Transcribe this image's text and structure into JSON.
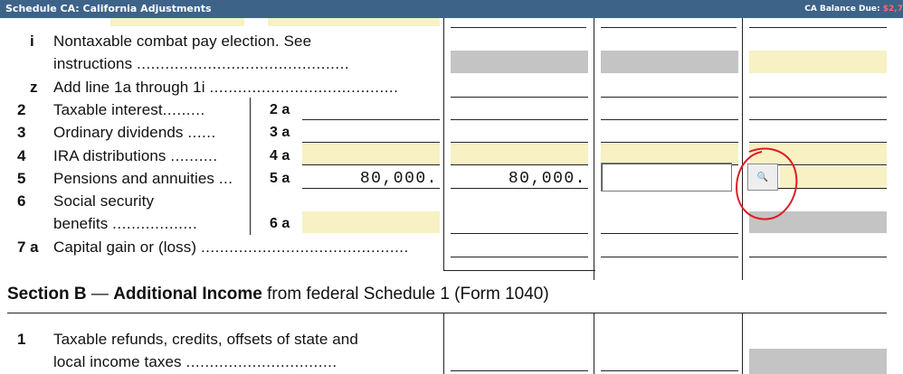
{
  "titlebar": {
    "title": "Schedule CA: California Adjustments",
    "balance_label": "CA Balance Due:",
    "balance_value": "$2,7"
  },
  "lines": {
    "i": {
      "num": "i",
      "text1": "Nontaxable combat pay election. See",
      "text2": "instructions",
      "dots": "............................................."
    },
    "z": {
      "num": "z",
      "text": "Add line 1a through 1i",
      "dots": "........................................"
    },
    "l2": {
      "num": "2",
      "text": "Taxable interest",
      "dots": ".........",
      "box": "2 a"
    },
    "l3": {
      "num": "3",
      "text": "Ordinary dividends",
      "dots": "......",
      "box": "3 a"
    },
    "l4": {
      "num": "4",
      "text": "IRA distributions",
      "dots": "..........",
      "box": "4 a"
    },
    "l5": {
      "num": "5",
      "text": "Pensions and annuities",
      "dots": "...",
      "box": "5 a",
      "col_a": "80,000.",
      "col_b": "80,000."
    },
    "l6": {
      "num": "6",
      "text1": "Social security",
      "text2": "benefits",
      "dots": "..................",
      "box": "6 a"
    },
    "l7": {
      "num": "7 a",
      "text": "Capital gain or (loss)",
      "dots": "............................................"
    }
  },
  "section_b": {
    "prefix": "Section B",
    "dash": " — ",
    "title": "Additional Income",
    "suffix": " from federal Schedule 1 (Form 1040)"
  },
  "sb_line1": {
    "num": "1",
    "text1": "Taxable refunds, credits, offsets of state and",
    "text2": "local income taxes",
    "dots": "................................"
  },
  "edit_field": {
    "value": ""
  },
  "icons": {
    "zoom": "magnifier-icon"
  },
  "colors": {
    "titlebar": "#3d6389",
    "entry_yellow": "#f7f1c4",
    "disabled_grey": "#c4c4c4",
    "annotation_red": "#e01b24"
  }
}
